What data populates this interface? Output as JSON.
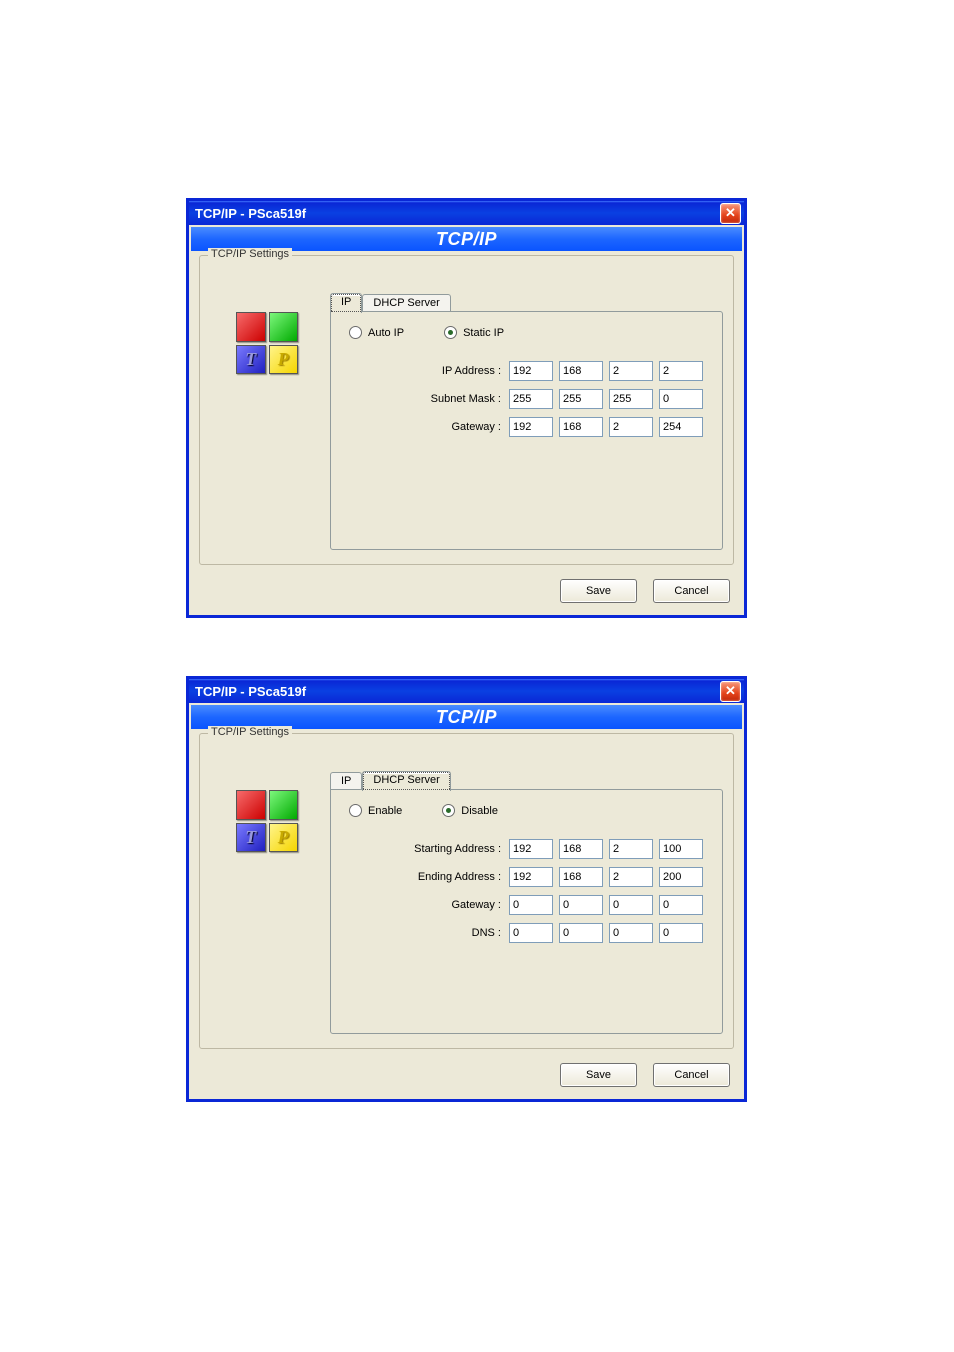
{
  "dialogs": [
    {
      "title": "TCP/IP - PSca519f",
      "banner": "TCP/IP",
      "group_label": "TCP/IP Settings",
      "tabs": {
        "ip": "IP",
        "dhcp": "DHCP Server",
        "active": "ip"
      },
      "radios": {
        "a": "Auto IP",
        "b": "Static IP",
        "selected": "b"
      },
      "rows": [
        {
          "label": "IP Address :",
          "octets": [
            "192",
            "168",
            "2",
            "2"
          ]
        },
        {
          "label": "Subnet Mask :",
          "octets": [
            "255",
            "255",
            "255",
            "0"
          ]
        },
        {
          "label": "Gateway :",
          "octets": [
            "192",
            "168",
            "2",
            "254"
          ]
        }
      ],
      "buttons": {
        "save": "Save",
        "cancel": "Cancel"
      }
    },
    {
      "title": "TCP/IP - PSca519f",
      "banner": "TCP/IP",
      "group_label": "TCP/IP Settings",
      "tabs": {
        "ip": "IP",
        "dhcp": "DHCP Server",
        "active": "dhcp"
      },
      "radios": {
        "a": "Enable",
        "b": "Disable",
        "selected": "b"
      },
      "rows": [
        {
          "label": "Starting Address :",
          "octets": [
            "192",
            "168",
            "2",
            "100"
          ]
        },
        {
          "label": "Ending Address :",
          "octets": [
            "192",
            "168",
            "2",
            "200"
          ]
        },
        {
          "label": "Gateway :",
          "octets": [
            "0",
            "0",
            "0",
            "0"
          ]
        },
        {
          "label": "DNS :",
          "octets": [
            "0",
            "0",
            "0",
            "0"
          ]
        }
      ],
      "buttons": {
        "save": "Save",
        "cancel": "Cancel"
      }
    }
  ]
}
